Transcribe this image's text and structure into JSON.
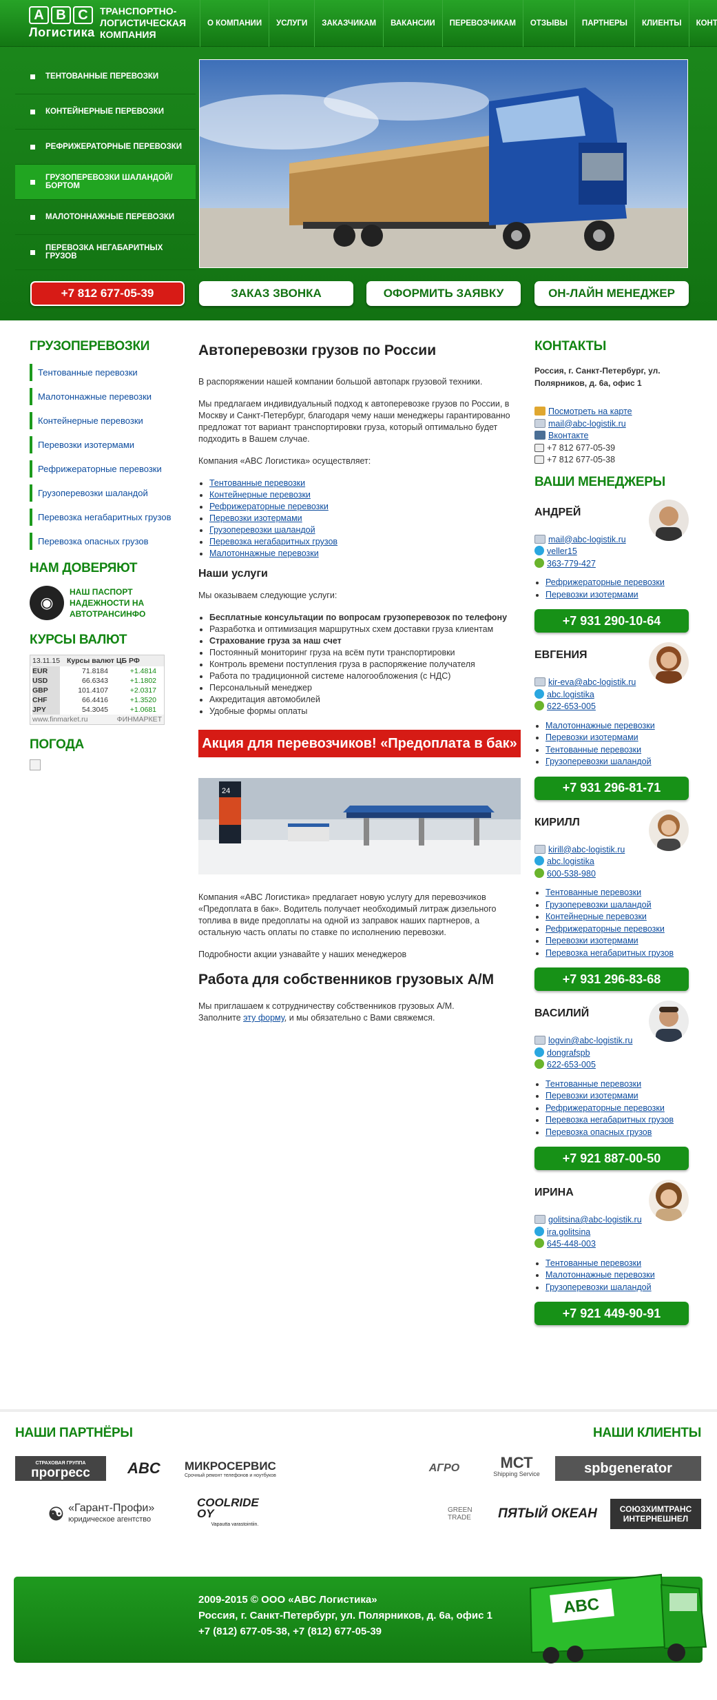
{
  "header": {
    "logo_letters": [
      "A",
      "B",
      "C"
    ],
    "logo_name": "Логистика",
    "tagline": "Транспортно-логистическая компания",
    "nav": [
      "О компании",
      "Услуги",
      "Заказчикам",
      "Вакансии",
      "Перевозчикам",
      "Отзывы",
      "Партнеры",
      "Клиенты",
      "Контакты"
    ]
  },
  "side_menu": [
    "Тентованные перевозки",
    "Контейнерные перевозки",
    "Рефрижераторные перевозки",
    "Грузоперевозки шаландой/бортом",
    "Малотоннажные перевозки",
    "Перевозка негабаритных грузов"
  ],
  "action_buttons": {
    "phone": "+7 812 677-05-39",
    "call": "Заказ звонка",
    "order": "Оформить заявку",
    "online": "Он-лайн менеджер"
  },
  "left": {
    "cargo_title": "Грузоперевозки",
    "cargo_links": [
      "Тентованные перевозки",
      "Малотоннажные перевозки",
      "Контейнерные перевозки",
      "Перевозки изотермами",
      "Рефрижераторные перевозки",
      "Грузоперевозки шаландой",
      "Перевозка негабаритных грузов",
      "Перевозка опасных грузов"
    ],
    "trust_title": "Нам доверяют",
    "trust_text": "Наш паспорт надежности на автотрансинфо",
    "rates_title": "Курсы валют",
    "rates_date": "13.11.15",
    "rates_header": "Курсы валют ЦБ РФ",
    "rates": [
      {
        "cur": "EUR",
        "val": "71.8184",
        "chg": "+1.4814"
      },
      {
        "cur": "USD",
        "val": "66.6343",
        "chg": "+1.1802"
      },
      {
        "cur": "GBP",
        "val": "101.4107",
        "chg": "+2.0317"
      },
      {
        "cur": "CHF",
        "val": "66.4416",
        "chg": "+1.3520"
      },
      {
        "cur": "JPY",
        "val": "54.3045",
        "chg": "+1.0681"
      }
    ],
    "rates_src": "www.finmarket.ru",
    "rates_brand": "ФИНМАРКЕТ",
    "weather_title": "Погода"
  },
  "center": {
    "title": "Автоперевозки грузов по России",
    "p1": "В распоряжении нашей компании большой автопарк грузовой техники.",
    "p2": "Мы предлагаем индивидуальный подход к автоперевозке грузов по России, в Москву и Санкт-Петербург, благодаря чему наши менеджеры гарантированно предложат тот вариант транспортировки груза, который оптимально будет подходить в Вашем случае.",
    "p3": "Компания «ABC Логистика» осуществляет:",
    "services_links": [
      "Тентованные перевозки",
      "Контейнерные перевозки",
      "Рефрижераторные перевозки",
      "Перевозки изотермами",
      "Грузоперевозки шаландой",
      "Перевозка негабаритных грузов",
      "Малотоннажные перевозки"
    ],
    "our_title": "Наши услуги",
    "our_intro": "Мы оказываем следующие услуги:",
    "our_list": [
      "Бесплатные консультации по вопросам грузоперевозок по телефону",
      "Разработка и оптимизация маршрутных схем доставки груза клиентам",
      "Страхование груза за наш счет",
      "Постоянный мониторинг груза на всём пути транспортировки",
      "Контроль времени поступления груза в распоряжение получателя",
      "Работа по традиционной системе налогообложения (с НДС)",
      "Персональный менеджер",
      "Аккредитация автомобилей",
      "Удобные формы оплаты"
    ],
    "promo": "Акция для перевозчиков! «Предоплата в бак»",
    "station_sign": "24",
    "p4": "Компания «ABC Логистика» предлагает новую услугу для перевозчиков «Предоплата в бак». Водитель получает необходимый литраж дизельного топлива в виде предоплаты на одной из заправок наших партнеров, а остальную часть оплаты по ставке по исполнению перевозки.",
    "p5": "Подробности акции узнавайте у наших менеджеров",
    "work_title": "Работа для собственников грузовых А/М",
    "work_p1": "Мы приглашаем к сотрудничеству собственников грузовых А/М.",
    "work_p2a": "Заполните ",
    "work_link": "эту форму",
    "work_p2b": ", и мы обязательно с Вами свяжемся."
  },
  "right": {
    "contacts_title": "Контакты",
    "address": "Россия, г. Санкт-Петербург, ул. Полярников, д. 6а, офис 1",
    "map": "Посмотреть на карте",
    "email": "mail@abc-logistik.ru",
    "vk": "Вконтакте",
    "phone1": "+7 812 677-05-39",
    "phone2": "+7 812 677-05-38",
    "managers_title": "Ваши менеджеры",
    "managers": [
      {
        "name": "Андрей",
        "mail": "mail@abc-logistik.ru",
        "skype": "veller15",
        "icq": "363-779-427",
        "links": [
          "Рефрижераторные перевозки",
          "Перевозки изотермами"
        ],
        "phone": "+7 931 290-10-64"
      },
      {
        "name": "Евгения",
        "mail": "kir-eva@abc-logistik.ru",
        "skype": "abc.logistika",
        "icq": "622-653-005",
        "links": [
          "Малотоннажные перевозки",
          "Перевозки изотермами",
          "Тентованные перевозки",
          "Грузоперевозки шаландой"
        ],
        "phone": "+7 931 296-81-71"
      },
      {
        "name": "Кирилл",
        "mail": "kirill@abc-logistik.ru",
        "skype": "abc.logistika",
        "icq": "600-538-980",
        "links": [
          "Тентованные перевозки",
          "Грузоперевозки шаландой",
          "Контейнерные перевозки",
          "Рефрижераторные перевозки",
          "Перевозки изотермами",
          "Перевозка негабаритных грузов"
        ],
        "phone": "+7 931 296-83-68"
      },
      {
        "name": "Василий",
        "mail": "logvin@abc-logistik.ru",
        "skype": "dongrafspb",
        "icq": "622-653-005",
        "links": [
          "Тентованные перевозки",
          "Перевозки изотермами",
          "Рефрижераторные перевозки",
          "Перевозка негабаритных грузов",
          "Перевозка опасных грузов"
        ],
        "phone": "+7 921 887-00-50"
      },
      {
        "name": "Ирина",
        "mail": "golitsina@abc-logistik.ru",
        "skype": "ira.golitsina",
        "icq": "645-448-003",
        "links": [
          "Тентованные перевозки",
          "Малотоннажные перевозки",
          "Грузоперевозки шаландой"
        ],
        "phone": "+7 921 449-90-91"
      }
    ]
  },
  "partners": {
    "partners_title": "Наши партнёры",
    "clients_title": "Наши клиенты",
    "p_progress": "прогресс",
    "p_progress_small": "СТРАХОВАЯ ГРУППА",
    "p_abc": "ABC",
    "p_micro": "МИКРОСЕРВИС",
    "p_micro_small": "Срочный ремонт телефонов и ноутбуков",
    "p_garant": "«Гарант-Профи»",
    "p_garant_small": "юридическое агентство",
    "p_coolride": "COOLRIDE OY",
    "p_coolride_small": "Vapautta varastointiin.",
    "c_agro": "АГРО",
    "c_mct": "МСТ",
    "c_mct_small": "Shipping Service",
    "c_spb": "spbgenerator",
    "c_green": "GREEN TRADE",
    "c_ocean": "ПЯТЫЙ ОКЕАН",
    "c_soyuz": "СОЮЗХИМТРАНС ИНТЕРНЕШНЕЛ"
  },
  "footer": {
    "line1": "2009-2015 © ООО «ABC Логистика»",
    "line2": "Россия, г. Санкт-Петербург, ул. Полярников, д. 6а, офис 1",
    "line3": "+7 (812) 677-05-38, +7 (812) 677-05-39",
    "truck_brand": "ABC"
  },
  "colors": {
    "brand_green": "#128512",
    "accent_red": "#d61b15",
    "link_blue": "#0d4c9e"
  }
}
